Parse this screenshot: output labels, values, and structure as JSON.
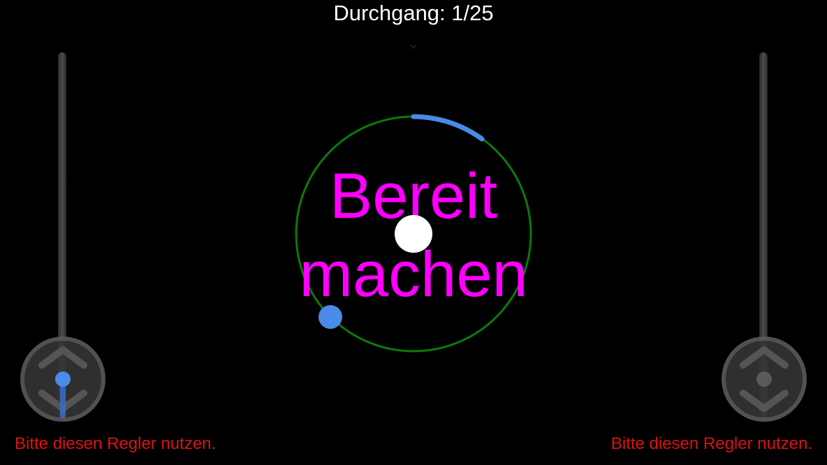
{
  "header": {
    "trial_counter": "Durchgang: 1/25"
  },
  "status": {
    "ready_line_1": "Bereit",
    "ready_line_2": "machen"
  },
  "controls": {
    "left_warning": "Bitte diesen Regler nutzen.",
    "right_warning": "Bitte diesen Regler nutzen."
  },
  "icons": {
    "joystick": "up-down-chevrons-icon",
    "top_marker": "small-chevron-icon"
  },
  "colors": {
    "background": "#000000",
    "ring": "#0a7a0a",
    "cursor": "#4a8ae8",
    "target_arc": "#4a8ae8",
    "center_dot": "#ffffff",
    "status_text": "#ff00ff",
    "warning_text": "#dd1111"
  }
}
